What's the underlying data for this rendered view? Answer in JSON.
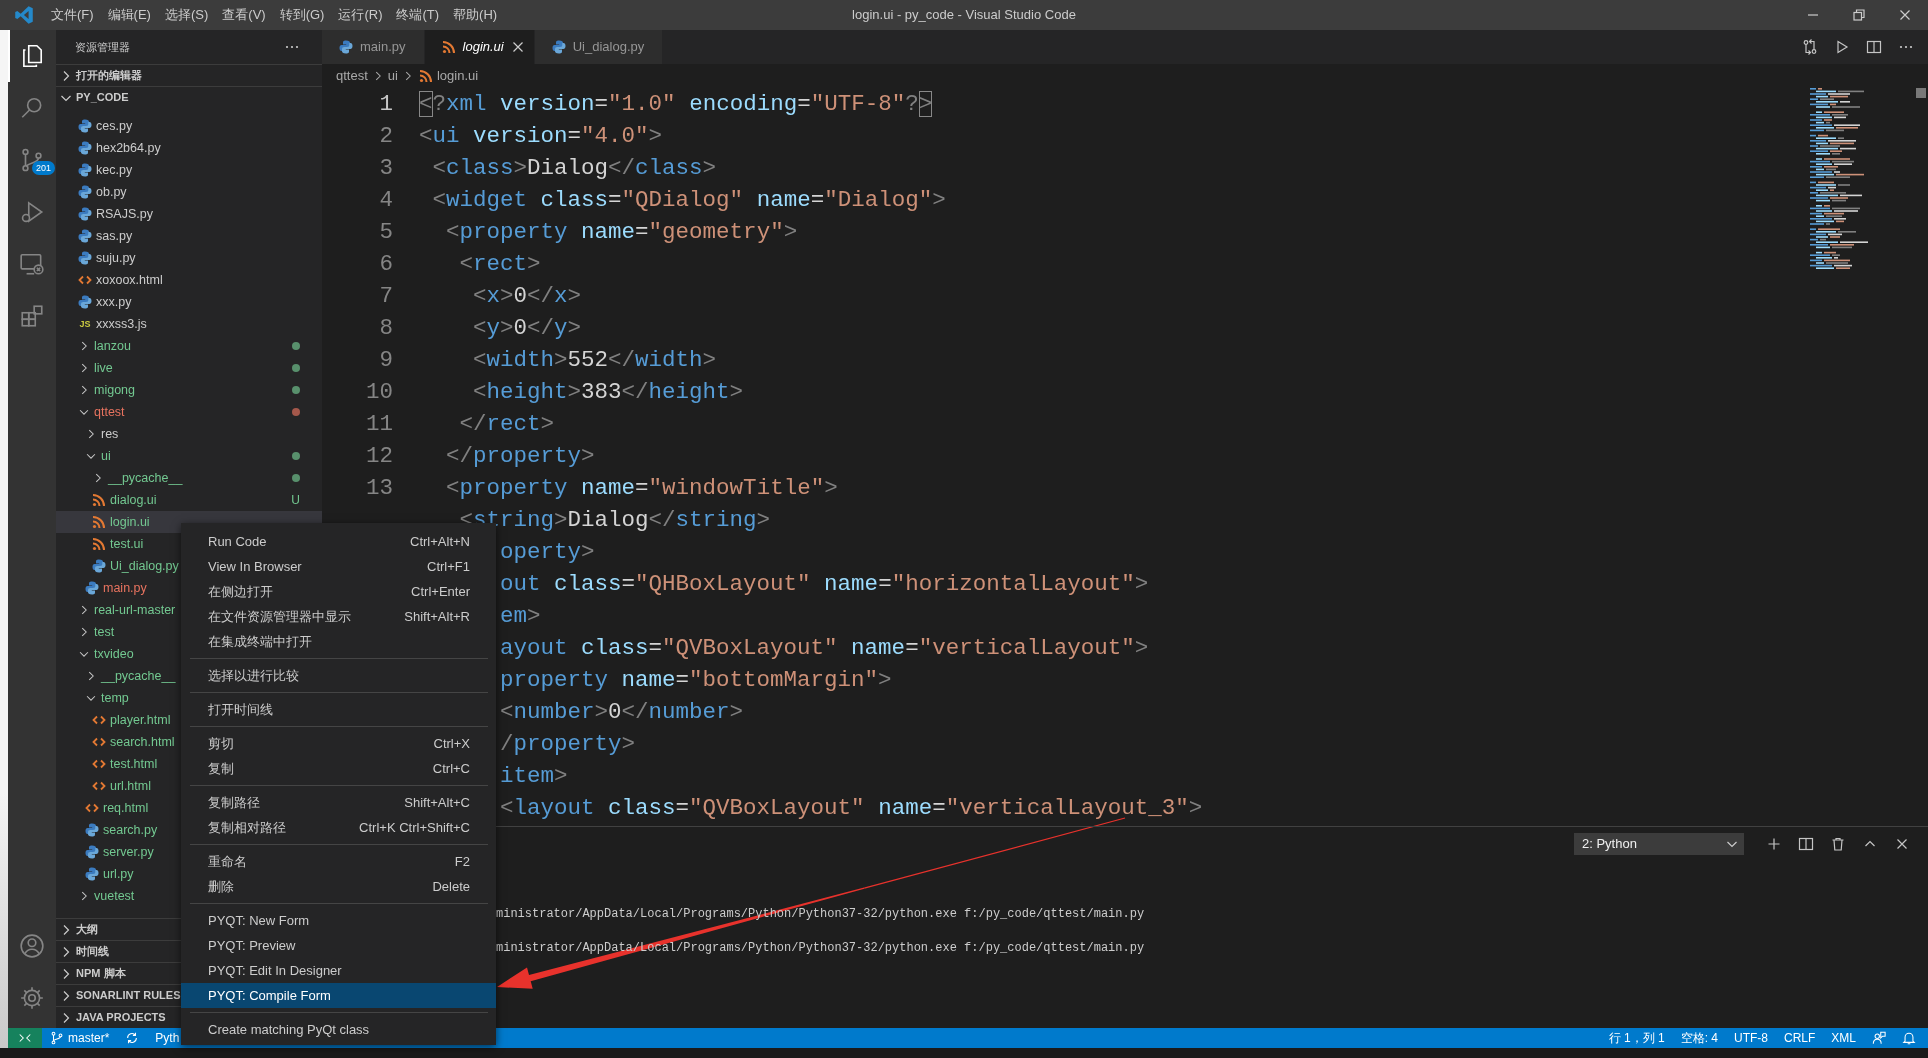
{
  "title_bar": {
    "menus": [
      "文件(F)",
      "编辑(E)",
      "选择(S)",
      "查看(V)",
      "转到(G)",
      "运行(R)",
      "终端(T)",
      "帮助(H)"
    ],
    "title": "login.ui - py_code - Visual Studio Code"
  },
  "activity_bar": {
    "items": [
      {
        "kind": "files",
        "selected": true
      },
      {
        "kind": "search",
        "selected": false
      },
      {
        "kind": "source-control",
        "selected": false,
        "badge": "201"
      },
      {
        "kind": "run",
        "selected": false
      },
      {
        "kind": "remote",
        "selected": false
      },
      {
        "kind": "extensions",
        "selected": false
      }
    ],
    "bottom": [
      {
        "kind": "account"
      },
      {
        "kind": "settings"
      }
    ]
  },
  "sidebar": {
    "title": "资源管理器",
    "sections_top": [
      {
        "label": "打开的编辑器",
        "expanded": false
      },
      {
        "label": "PY_CODE",
        "expanded": true
      }
    ],
    "tree": [
      {
        "name": "ces.py",
        "kind": "py",
        "color": "#cccccc",
        "selected": false
      },
      {
        "name": "hex2b64.py",
        "kind": "py",
        "color": "#cccccc",
        "selected": false
      },
      {
        "name": "kec.py",
        "kind": "py",
        "color": "#cccccc",
        "selected": false
      },
      {
        "name": "ob.py",
        "kind": "py",
        "color": "#cccccc",
        "selected": false
      },
      {
        "name": "RSAJS.py",
        "kind": "py",
        "color": "#cccccc",
        "selected": false
      },
      {
        "name": "sas.py",
        "kind": "py",
        "color": "#cccccc",
        "selected": false
      },
      {
        "name": "suju.py",
        "kind": "py",
        "color": "#cccccc",
        "selected": false
      },
      {
        "name": "xoxoox.html",
        "kind": "html",
        "color": "#cccccc",
        "selected": false
      },
      {
        "name": "xxx.py",
        "kind": "py",
        "color": "#cccccc",
        "selected": false
      },
      {
        "name": "xxxss3.js",
        "kind": "js",
        "icon_text": "JS",
        "color": "#cccccc",
        "selected": false
      },
      {
        "name": "lanzou",
        "kind": "folder",
        "expanded": false,
        "color": "#73c991",
        "dot": true,
        "selected": false
      },
      {
        "name": "live",
        "kind": "folder",
        "expanded": false,
        "color": "#73c991",
        "dot": true,
        "selected": false
      },
      {
        "name": "migong",
        "kind": "folder",
        "expanded": false,
        "color": "#73c991",
        "dot": true,
        "selected": false
      },
      {
        "name": "qttest",
        "kind": "folder",
        "expanded": true,
        "color": "#e8735f",
        "dot": true,
        "selected": false,
        "children": [
          {
            "name": "res",
            "kind": "folder",
            "expanded": false,
            "color": "#cccccc",
            "selected": false
          },
          {
            "name": "ui",
            "kind": "folder",
            "expanded": true,
            "color": "#73c991",
            "dot": true,
            "selected": false,
            "children": [
              {
                "name": "__pycache__",
                "kind": "folder",
                "expanded": false,
                "color": "#73c991",
                "dot": true,
                "selected": false
              },
              {
                "name": "dialog.ui",
                "kind": "ui",
                "color": "#73c991",
                "badge": "U",
                "selected": false
              },
              {
                "name": "login.ui",
                "kind": "ui",
                "color": "#73c991",
                "selected": true
              },
              {
                "name": "test.ui",
                "kind": "ui",
                "color": "#73c991",
                "selected": false
              },
              {
                "name": "Ui_dialog.py",
                "kind": "py",
                "color": "#73c991",
                "selected": false
              }
            ]
          },
          {
            "name": "main.py",
            "kind": "py",
            "color": "#e8735f",
            "selected": false
          }
        ]
      },
      {
        "name": "real-url-master",
        "kind": "folder",
        "expanded": false,
        "color": "#73c991",
        "selected": false
      },
      {
        "name": "test",
        "kind": "folder",
        "expanded": false,
        "color": "#73c991",
        "selected": false
      },
      {
        "name": "txvideo",
        "kind": "folder",
        "expanded": true,
        "color": "#73c991",
        "selected": false,
        "children": [
          {
            "name": "__pycache__",
            "kind": "folder",
            "expanded": false,
            "color": "#73c991",
            "selected": false
          },
          {
            "name": "temp",
            "kind": "folder",
            "expanded": true,
            "color": "#73c991",
            "selected": false,
            "children": [
              {
                "name": "player.html",
                "kind": "html",
                "color": "#73c991",
                "selected": false
              },
              {
                "name": "search.html",
                "kind": "html",
                "color": "#73c991",
                "selected": false
              },
              {
                "name": "test.html",
                "kind": "html",
                "color": "#73c991",
                "selected": false
              },
              {
                "name": "url.html",
                "kind": "html",
                "color": "#73c991",
                "selected": false
              }
            ]
          },
          {
            "name": "req.html",
            "kind": "html",
            "color": "#73c991",
            "selected": false
          },
          {
            "name": "search.py",
            "kind": "py",
            "color": "#73c991",
            "selected": false
          },
          {
            "name": "server.py",
            "kind": "py",
            "color": "#73c991",
            "selected": false
          },
          {
            "name": "url.py",
            "kind": "py",
            "color": "#73c991",
            "selected": false
          }
        ]
      },
      {
        "name": "vuetest",
        "kind": "folder",
        "expanded": false,
        "color": "#73c991",
        "selected": false
      }
    ],
    "sections_bottom": [
      {
        "label": "大纲",
        "expanded": false
      },
      {
        "label": "时间线",
        "expanded": false
      },
      {
        "label": "NPM 脚本",
        "expanded": false
      },
      {
        "label": "SONARLINT RULES",
        "expanded": false
      },
      {
        "label": "JAVA PROJECTS",
        "expanded": false
      }
    ]
  },
  "editor": {
    "tabs": [
      {
        "label": "main.py",
        "kind": "py",
        "selected": false,
        "preview": false
      },
      {
        "label": "login.ui",
        "kind": "ui",
        "selected": true,
        "preview": true
      },
      {
        "label": "Ui_dialog.py",
        "kind": "py",
        "selected": false,
        "preview": false
      }
    ],
    "breadcrumbs": [
      {
        "label": "qttest",
        "kind": "folder"
      },
      {
        "label": "ui",
        "kind": "folder"
      },
      {
        "label": "login.ui",
        "kind": "ui"
      }
    ],
    "lines": [
      {
        "kind": "full",
        "number": "1",
        "current": true,
        "bracket_match": true,
        "text": "<?xml version=\"1.0\" encoding=\"UTF-8\"?>"
      },
      {
        "kind": "full",
        "number": "2",
        "current": false,
        "bracket_match": false,
        "text": "<ui version=\"4.0\">"
      },
      {
        "kind": "full",
        "number": "3",
        "current": false,
        "bracket_match": false,
        "text": " <class>Dialog</class>"
      },
      {
        "kind": "full",
        "number": "4",
        "current": false,
        "bracket_match": false,
        "text": " <widget class=\"QDialog\" name=\"Dialog\">"
      },
      {
        "kind": "full",
        "number": "5",
        "current": false,
        "bracket_match": false,
        "text": "  <property name=\"geometry\">"
      },
      {
        "kind": "full",
        "number": "6",
        "current": false,
        "bracket_match": false,
        "text": "   <rect>"
      },
      {
        "kind": "full",
        "number": "7",
        "current": false,
        "bracket_match": false,
        "text": "    <x>0</x>"
      },
      {
        "kind": "full",
        "number": "8",
        "current": false,
        "bracket_match": false,
        "text": "    <y>0</y>"
      },
      {
        "kind": "full",
        "number": "9",
        "current": false,
        "bracket_match": false,
        "text": "    <width>552</width>"
      },
      {
        "kind": "full",
        "number": "10",
        "current": false,
        "bracket_match": false,
        "text": "    <height>383</height>"
      },
      {
        "kind": "full",
        "number": "11",
        "current": false,
        "bracket_match": false,
        "text": "   </rect>"
      },
      {
        "kind": "full",
        "number": "12",
        "current": false,
        "bracket_match": false,
        "text": "  </property>"
      },
      {
        "kind": "full",
        "number": "13",
        "current": false,
        "bracket_match": false,
        "text": "  <property name=\"windowTitle\">"
      },
      {
        "kind": "full",
        "bracket_match": false,
        "text": "   <string>Dialog</string>"
      },
      {
        "kind": "covered",
        "text": "operty>"
      },
      {
        "kind": "covered",
        "text": "out class=\"QHBoxLayout\" name=\"horizontalLayout\">"
      },
      {
        "kind": "covered",
        "text": "em>"
      },
      {
        "kind": "covered",
        "text": "ayout class=\"QVBoxLayout\" name=\"verticalLayout\">"
      },
      {
        "kind": "covered",
        "text": "property name=\"bottomMargin\">"
      },
      {
        "kind": "covered",
        "text": "<number>0</number>"
      },
      {
        "kind": "covered",
        "text": "/property>"
      },
      {
        "kind": "covered",
        "text": "item>"
      },
      {
        "kind": "covered",
        "text": "<layout class=\"QVBoxLayout\" name=\"verticalLayout_3\">"
      }
    ]
  },
  "panel": {
    "terminal_select": "2: Python",
    "lines": [
      "ministrator/AppData/Local/Programs/Python/Python37-32/python.exe f:/py_code/qttest/main.py",
      "ministrator/AppData/Local/Programs/Python/Python37-32/python.exe f:/py_code/qttest/main.py"
    ]
  },
  "status_bar": {
    "branch": "master*",
    "interpreter": "Pyth",
    "right": [
      "行 1，列 1",
      "空格: 4",
      "UTF-8",
      "CRLF",
      "XML"
    ]
  },
  "context_menu": {
    "items": [
      {
        "kind": "item",
        "label": "Run Code",
        "shortcut": "Ctrl+Alt+N",
        "selected": false
      },
      {
        "kind": "item",
        "label": "View In Browser",
        "shortcut": "Ctrl+F1",
        "selected": false
      },
      {
        "kind": "item",
        "label": "在侧边打开",
        "shortcut": "Ctrl+Enter",
        "selected": false
      },
      {
        "kind": "item",
        "label": "在文件资源管理器中显示",
        "shortcut": "Shift+Alt+R",
        "selected": false
      },
      {
        "kind": "item",
        "label": "在集成终端中打开",
        "selected": false
      },
      {
        "kind": "separator"
      },
      {
        "kind": "item",
        "label": "选择以进行比较",
        "selected": false
      },
      {
        "kind": "separator"
      },
      {
        "kind": "item",
        "label": "打开时间线",
        "selected": false
      },
      {
        "kind": "separator"
      },
      {
        "kind": "item",
        "label": "剪切",
        "shortcut": "Ctrl+X",
        "selected": false
      },
      {
        "kind": "item",
        "label": "复制",
        "shortcut": "Ctrl+C",
        "selected": false
      },
      {
        "kind": "separator"
      },
      {
        "kind": "item",
        "label": "复制路径",
        "shortcut": "Shift+Alt+C",
        "selected": false
      },
      {
        "kind": "item",
        "label": "复制相对路径",
        "shortcut": "Ctrl+K Ctrl+Shift+C",
        "selected": false
      },
      {
        "kind": "separator"
      },
      {
        "kind": "item",
        "label": "重命名",
        "shortcut": "F2",
        "selected": false
      },
      {
        "kind": "item",
        "label": "删除",
        "shortcut": "Delete",
        "selected": false
      },
      {
        "kind": "separator"
      },
      {
        "kind": "item",
        "label": "PYQT: New Form",
        "selected": false
      },
      {
        "kind": "item",
        "label": "PYQT: Preview",
        "selected": false
      },
      {
        "kind": "item",
        "label": "PYQT: Edit In Designer",
        "selected": false
      },
      {
        "kind": "item",
        "label": "PYQT: Compile Form",
        "selected": true
      },
      {
        "kind": "separator"
      },
      {
        "kind": "item",
        "label": "Create matching PyQt class",
        "selected": false
      }
    ]
  }
}
